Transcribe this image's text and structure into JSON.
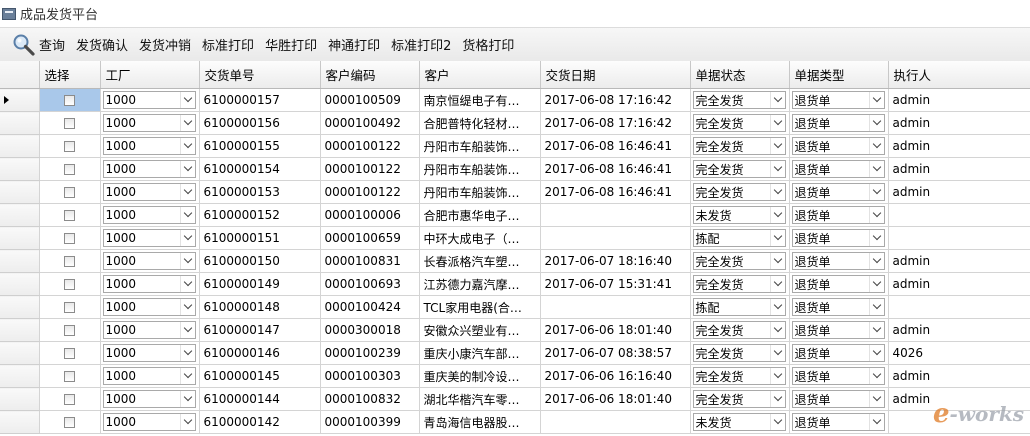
{
  "window": {
    "title": "成品发货平台"
  },
  "toolbar": {
    "buttons": [
      "查询",
      "发货确认",
      "发货冲销",
      "标准打印",
      "华胜打印",
      "神通打印",
      "标准打印2",
      "货格打印"
    ]
  },
  "grid": {
    "columns": [
      "选择",
      "工厂",
      "交货单号",
      "客户编码",
      "客户",
      "交货日期",
      "单据状态",
      "单据类型",
      "执行人"
    ],
    "rows": [
      {
        "plant": "1000",
        "delivery_no": "6100000157",
        "customer_code": "0000100509",
        "customer": "南京恒缇电子有…",
        "date": "2017-06-08 17:16:42",
        "status": "完全发货",
        "type": "退货单",
        "executor": "admin"
      },
      {
        "plant": "1000",
        "delivery_no": "6100000156",
        "customer_code": "0000100492",
        "customer": "合肥普特化轻材…",
        "date": "2017-06-08 17:16:42",
        "status": "完全发货",
        "type": "退货单",
        "executor": "admin"
      },
      {
        "plant": "1000",
        "delivery_no": "6100000155",
        "customer_code": "0000100122",
        "customer": "丹阳市车船装饰…",
        "date": "2017-06-08 16:46:41",
        "status": "完全发货",
        "type": "退货单",
        "executor": "admin"
      },
      {
        "plant": "1000",
        "delivery_no": "6100000154",
        "customer_code": "0000100122",
        "customer": "丹阳市车船装饰…",
        "date": "2017-06-08 16:46:41",
        "status": "完全发货",
        "type": "退货单",
        "executor": "admin"
      },
      {
        "plant": "1000",
        "delivery_no": "6100000153",
        "customer_code": "0000100122",
        "customer": "丹阳市车船装饰…",
        "date": "2017-06-08 16:46:41",
        "status": "完全发货",
        "type": "退货单",
        "executor": "admin"
      },
      {
        "plant": "1000",
        "delivery_no": "6100000152",
        "customer_code": "0000100006",
        "customer": "合肥市惠华电子…",
        "date": "",
        "status": "未发货",
        "type": "退货单",
        "executor": ""
      },
      {
        "plant": "1000",
        "delivery_no": "6100000151",
        "customer_code": "0000100659",
        "customer": "中环大成电子（…",
        "date": "",
        "status": "拣配",
        "type": "退货单",
        "executor": ""
      },
      {
        "plant": "1000",
        "delivery_no": "6100000150",
        "customer_code": "0000100831",
        "customer": "长春派格汽车塑…",
        "date": "2017-06-07 18:16:40",
        "status": "完全发货",
        "type": "退货单",
        "executor": "admin"
      },
      {
        "plant": "1000",
        "delivery_no": "6100000149",
        "customer_code": "0000100693",
        "customer": "江苏德力嘉汽摩…",
        "date": "2017-06-07 15:31:41",
        "status": "完全发货",
        "type": "退货单",
        "executor": "admin"
      },
      {
        "plant": "1000",
        "delivery_no": "6100000148",
        "customer_code": "0000100424",
        "customer": "TCL家用电器(合…",
        "date": "",
        "status": "拣配",
        "type": "退货单",
        "executor": ""
      },
      {
        "plant": "1000",
        "delivery_no": "6100000147",
        "customer_code": "0000300018",
        "customer": "安徽众兴塑业有…",
        "date": "2017-06-06 18:01:40",
        "status": "完全发货",
        "type": "退货单",
        "executor": "admin"
      },
      {
        "plant": "1000",
        "delivery_no": "6100000146",
        "customer_code": "0000100239",
        "customer": "重庆小康汽车部…",
        "date": "2017-06-07 08:38:57",
        "status": "完全发货",
        "type": "退货单",
        "executor": "4026"
      },
      {
        "plant": "1000",
        "delivery_no": "6100000145",
        "customer_code": "0000100303",
        "customer": "重庆美的制冷设…",
        "date": "2017-06-06 16:16:40",
        "status": "完全发货",
        "type": "退货单",
        "executor": "admin"
      },
      {
        "plant": "1000",
        "delivery_no": "6100000144",
        "customer_code": "0000100832",
        "customer": "湖北华楷汽车零…",
        "date": "2017-06-06 18:01:40",
        "status": "完全发货",
        "type": "退货单",
        "executor": "admin"
      },
      {
        "plant": "1000",
        "delivery_no": "6100000142",
        "customer_code": "0000100399",
        "customer": "青岛海信电器股…",
        "date": "",
        "status": "未发货",
        "type": "退货单",
        "executor": ""
      }
    ]
  },
  "watermark": {
    "text_e": "e",
    "text_rest": "-works"
  },
  "icons": {
    "search": "search-icon",
    "app": "app-icon",
    "row_pointer": "current-row-arrow-icon",
    "dropdown": "chevron-down-icon"
  }
}
